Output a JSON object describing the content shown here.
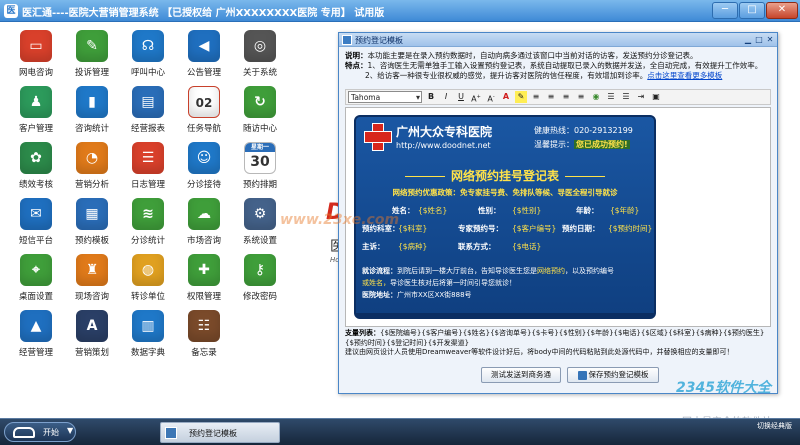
{
  "window": {
    "app_icon": "医",
    "title": "医汇通----医院大营销管理系统  【已授权给 广州XXXXXXXX医院 专用】 试用版",
    "minimize": "─",
    "maximize": "□",
    "close": "✕"
  },
  "desktop_icons": [
    {
      "label": "网电咨询",
      "icon": "monitor-icon",
      "color": "#d9402b"
    },
    {
      "label": "投诉管理",
      "icon": "notepad-icon",
      "color": "#3f9e3a"
    },
    {
      "label": "呼叫中心",
      "icon": "headset-icon",
      "color": "#1f78c8"
    },
    {
      "label": "公告管理",
      "icon": "megaphone-icon",
      "color": "#1f6fbf"
    },
    {
      "label": "关于系统",
      "icon": "camera-icon",
      "color": "#555555"
    },
    {
      "label": "客户管理",
      "icon": "users-icon",
      "color": "#2c9a5b"
    },
    {
      "label": "咨询统计",
      "icon": "bar-chart-icon",
      "color": "#1f78c8"
    },
    {
      "label": "经营报表",
      "icon": "chart-report-icon",
      "color": "#2a6db8"
    },
    {
      "label": "任务导航",
      "icon": "calendar-icon",
      "color": "#c8402b"
    },
    {
      "label": "随访中心",
      "icon": "refresh-icon",
      "color": "#3f9e3a"
    },
    {
      "label": "绩效考核",
      "icon": "flower-icon",
      "color": "#2c8a4a"
    },
    {
      "label": "营销分析",
      "icon": "pie-chart-icon",
      "color": "#e07a1a"
    },
    {
      "label": "日志管理",
      "icon": "log-icon",
      "color": "#d9402b"
    },
    {
      "label": "分诊接待",
      "icon": "reception-icon",
      "color": "#1f78c8"
    },
    {
      "label": "预约排期",
      "icon": "calendar-30-icon",
      "color": "#ffffff"
    },
    {
      "label": "短信平台",
      "icon": "sms-icon",
      "color": "#1f6fbf"
    },
    {
      "label": "预约模板",
      "icon": "template-icon",
      "color": "#2a6db8"
    },
    {
      "label": "分诊统计",
      "icon": "layers-icon",
      "color": "#3f9e3a"
    },
    {
      "label": "市场咨询",
      "icon": "chat-icon",
      "color": "#3f9e3a"
    },
    {
      "label": "系统设置",
      "icon": "settings-icon",
      "color": "#44628a"
    },
    {
      "label": "桌面设置",
      "icon": "map-icon",
      "color": "#3f9e3a"
    },
    {
      "label": "现场咨询",
      "icon": "chair-icon",
      "color": "#e07a1a"
    },
    {
      "label": "转诊单位",
      "icon": "globe-icon",
      "color": "#e0a020"
    },
    {
      "label": "权限管理",
      "icon": "puzzle-icon",
      "color": "#3f9e3a"
    },
    {
      "label": "修改密码",
      "icon": "key-icon",
      "color": "#3f9e3a"
    },
    {
      "label": "经营管理",
      "icon": "stamp-icon",
      "color": "#1f6fbf"
    },
    {
      "label": "营销策划",
      "icon": "app-icon",
      "color": "#2a3f66"
    },
    {
      "label": "数据字典",
      "icon": "books-icon",
      "color": "#1f78c8"
    },
    {
      "label": "备忘录",
      "icon": "address-book-icon",
      "color": "#7a4a2a"
    }
  ],
  "calendar_icon": {
    "top": "星期一",
    "day": "30"
  },
  "background": {
    "logo": "D",
    "text1": "医",
    "text2": "Ho"
  },
  "dialog": {
    "title": "预约登记模板",
    "desc_label_1": "说明：",
    "desc_text_1": "本功能主要是在录入预约数据时，自动向病多通过该窗口中当前对话的访客，发送预约分诊登记表。",
    "desc_label_2": "特点：",
    "desc_text_2": "1、咨询医生无需单独手工输入设置预约登记表，系统自动提取已录入的数据并发送，全自动完成，有效提升工作效率。",
    "desc_text_3": "2、给访客一种很专业很权威的感觉，提升访客对医院的信任程度，有效增加到诊率。",
    "desc_link": "点击这里查看更多模板",
    "font": "Tahoma",
    "vars_label": "支量列表：",
    "vars_text": "{$医院编号}{$客户编号}{$姓名}{$咨询单号}{$卡号}{$性别}{$年龄}{$电话}{$区域}{$科室}{$病种}{$预约医生}{$预约时间}{$登记时间}{$开发渠道}",
    "vars_note": "建议由网页设计人员使用Dreamweaver等软件设计好后，将body中间的代码粘贴到此处源代码中，并替换相应的支量即可！",
    "btn_test": "测试发送到商务通",
    "btn_save": "保存预约登记模板"
  },
  "card": {
    "hospital": "广州大众专科医院",
    "url": "http://www.doodnet.net",
    "hotline": "健康热线：020-29132199",
    "tip_label": "温馨提示：",
    "tip_main": "您已成功预约!",
    "title": "网络预约挂号登记表",
    "policy": "网络预约优惠政策：免专家挂号费、免排队等候、导医全程引导就诊",
    "rows": [
      [
        {
          "l": "姓名：",
          "v": "{$姓名}"
        },
        {
          "l": "性别：",
          "v": "{$性别}"
        },
        {
          "l": "年龄：",
          "v": "{$年龄}"
        }
      ],
      [
        {
          "l": "预约科室：",
          "v": "{$科室}"
        },
        {
          "l": "专家预约号：",
          "v": "{$客户编号}"
        },
        {
          "l": "预约日期：",
          "v": "{$预约时间}"
        }
      ],
      [
        {
          "l": "主诉：",
          "v": "{$病种}"
        },
        {
          "l": "联系方式：",
          "v": "{$电话}"
        },
        {
          "l": "",
          "v": ""
        }
      ]
    ],
    "notice_label": "就诊流程：",
    "notice_text": "到院后请到一楼大厅前台，告知导诊医生您是",
    "notice_hl": "网络预约",
    "notice_text2": "，以及预约编号",
    "notice_line2_hl": "或姓名，",
    "notice_line2": "导诊医生核对后将第一时间引导您就诊！",
    "address_label": "医院地址：",
    "address": "广州市XX区XX街888号"
  },
  "taskbar": {
    "start_label": "开始",
    "caret": "▼",
    "task_label": "预约登记模板",
    "tray": "切换经典版"
  },
  "watermarks": {
    "w1": "2345软件大全",
    "w2": "国内最安全的软件站",
    "w3": "www.23xe.com"
  }
}
